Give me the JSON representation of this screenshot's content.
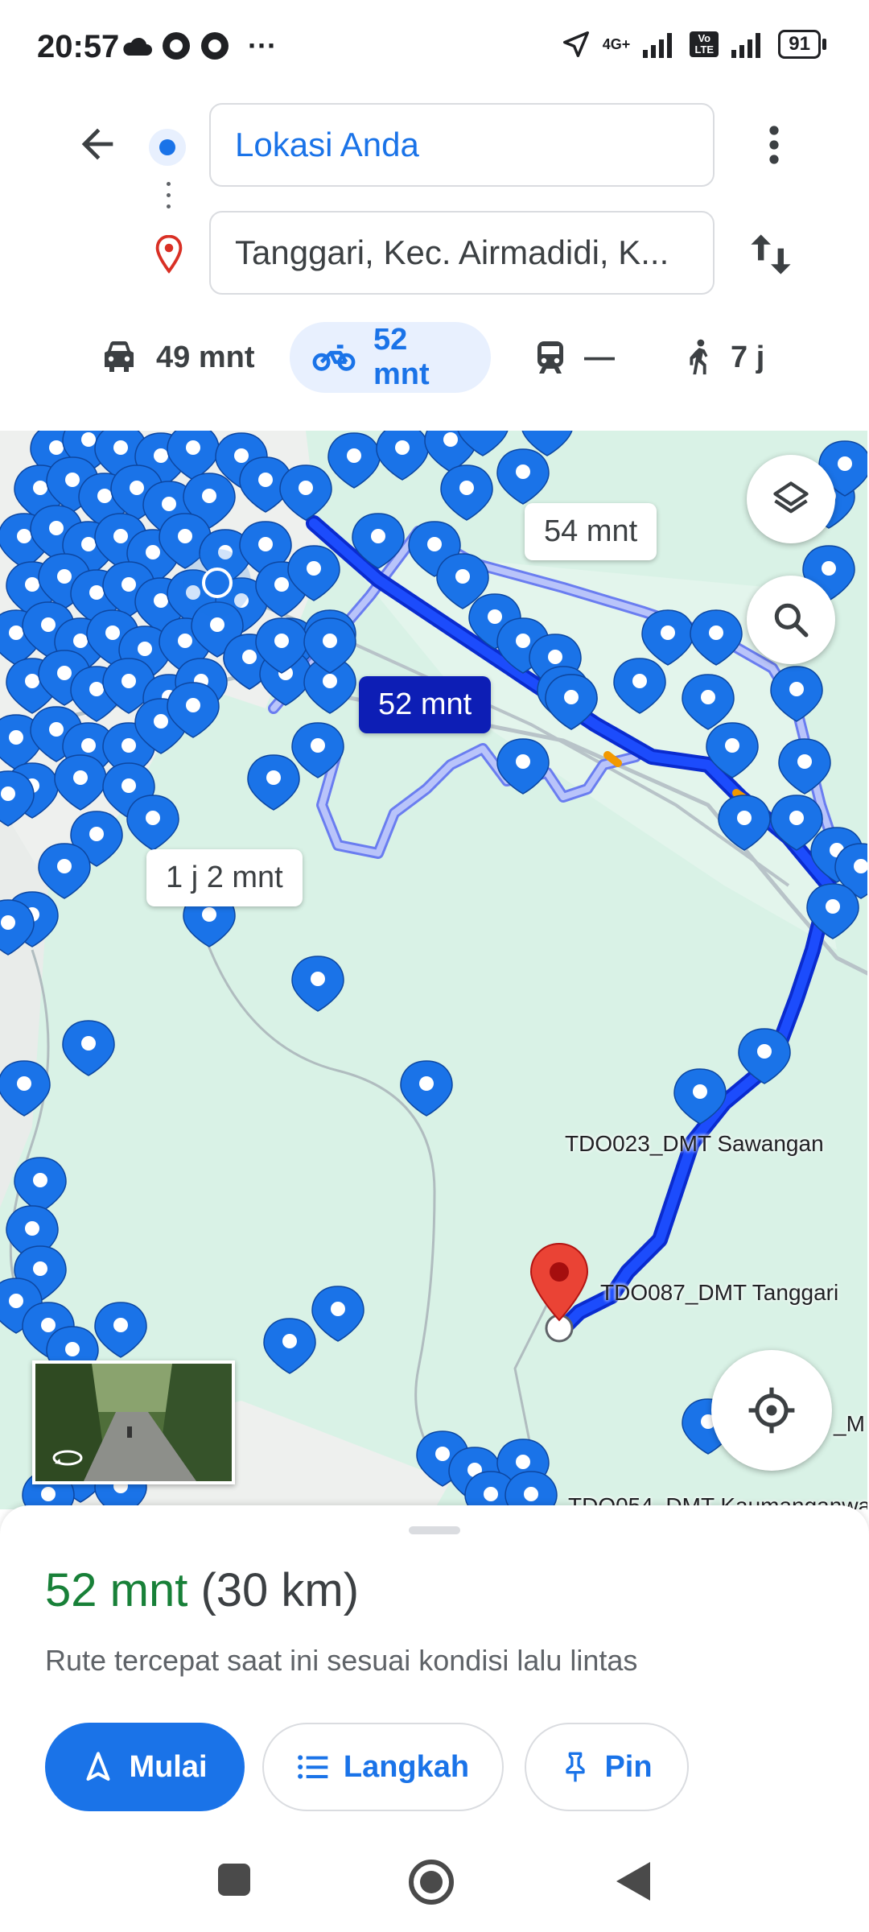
{
  "status_bar": {
    "time": "20:57",
    "more": "···",
    "network": "4G+",
    "volte": "Vo LTE",
    "battery": "91"
  },
  "directions": {
    "origin": "Lokasi Anda",
    "destination": "Tanggari, Kec. Airmadidi, K..."
  },
  "modes": [
    {
      "name": "car",
      "label": "49 mnt"
    },
    {
      "name": "motorcycle",
      "label": "52 mnt",
      "active": true
    },
    {
      "name": "transit",
      "label": "—"
    },
    {
      "name": "walk",
      "label": "7 j"
    }
  ],
  "map": {
    "route_labels": {
      "selected": "52 mnt",
      "alt1": "54 mnt",
      "alt2": "1 j 2 mnt"
    },
    "places": {
      "sawangan": "TDO023_DMT Sawangan",
      "tanggari": "TDO087_DMT Tanggari",
      "partial_right": "_M",
      "partial_bottom": "TDO054_DMT Kaumanganwa"
    },
    "colors": {
      "route_primary": "#0b3bf5",
      "route_alt": "#aab7f5",
      "pin": "#1a73e8",
      "destination": "#ea4335"
    }
  },
  "sheet": {
    "duration": "52 mnt",
    "distance": "(30 km)",
    "description": "Rute tercepat saat ini sesuai kondisi lalu lintas",
    "start_label": "Mulai",
    "steps_label": "Langkah",
    "pin_label": "Pin"
  }
}
